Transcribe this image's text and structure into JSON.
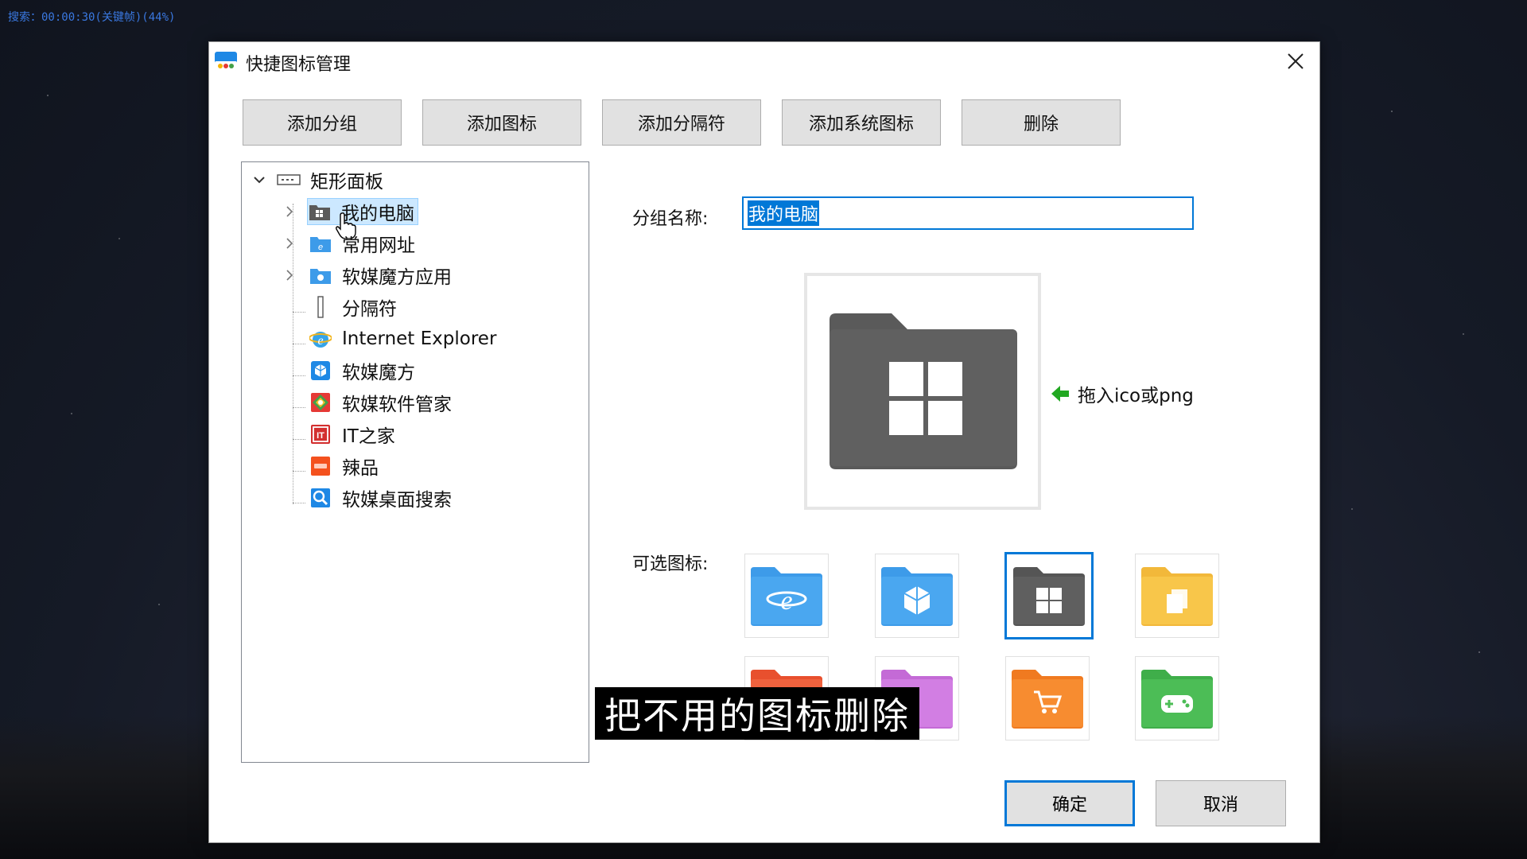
{
  "status_text": "搜索：00:00:30(关键帧)(44%)",
  "dialog": {
    "title": "快捷图标管理",
    "toolbar": {
      "add_group": "添加分组",
      "add_icon": "添加图标",
      "add_separator": "添加分隔符",
      "add_system_icon": "添加系统图标",
      "delete": "删除"
    },
    "tree": {
      "root": "矩形面板",
      "items": [
        {
          "label": "我的电脑",
          "icon": "folder-windows-icon",
          "expandable": true,
          "selected": true
        },
        {
          "label": "常用网址",
          "icon": "folder-ie-icon",
          "expandable": true
        },
        {
          "label": "软媒魔方应用",
          "icon": "folder-app-icon",
          "expandable": true
        },
        {
          "label": "分隔符",
          "icon": "separator-icon"
        },
        {
          "label": "Internet Explorer",
          "icon": "ie-icon"
        },
        {
          "label": "软媒魔方",
          "icon": "mofang-icon"
        },
        {
          "label": "软媒软件管家",
          "icon": "software-manager-icon"
        },
        {
          "label": "IT之家",
          "icon": "ithome-icon"
        },
        {
          "label": "辣品",
          "icon": "lapin-icon"
        },
        {
          "label": "软媒桌面搜索",
          "icon": "desktop-search-icon"
        }
      ]
    },
    "group_name_label": "分组名称:",
    "group_name_value": "我的电脑",
    "drop_hint": "拖入ico或png",
    "optional_icons_label": "可选图标:",
    "optional_icons": [
      "folder-ie-icon",
      "folder-app-icon",
      "folder-windows-icon",
      "folder-documents-icon",
      "folder-red-icon",
      "folder-purple-icon",
      "folder-cart-icon",
      "folder-game-icon"
    ],
    "ok": "确定",
    "cancel": "取消"
  },
  "subtitle": "把不用的图标删除",
  "colors": {
    "accent": "#0078d7",
    "selection": "#cce8ff",
    "folder_blue": "#3d9be9",
    "folder_dark": "#5a5a5a"
  }
}
